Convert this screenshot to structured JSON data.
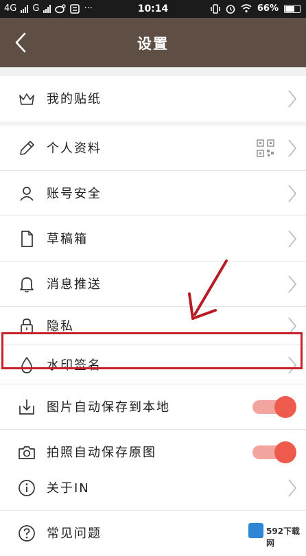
{
  "status_bar": {
    "signal_left": "4G",
    "signal_mid": "G",
    "time": "10:14",
    "battery": "66%"
  },
  "header": {
    "title": "设置"
  },
  "settings": {
    "stickers": "我的贴纸",
    "profile": "个人资料",
    "account_security": "账号安全",
    "drafts": "草稿箱",
    "notifications": "消息推送",
    "privacy": "隐私",
    "watermark_signature": "水印签名",
    "auto_save_pictures": "图片自动保存到本地",
    "auto_save_photos": "拍照自动保存原图",
    "about": "关于IN",
    "faq": "常见问题"
  },
  "toggles": {
    "auto_save_pictures": true,
    "auto_save_photos": true
  },
  "colors": {
    "header_bg": "#5e4e44",
    "toggle_on": "#ee5a4c",
    "highlight": "#c8202a"
  },
  "watermark": {
    "text": "592下载网"
  }
}
